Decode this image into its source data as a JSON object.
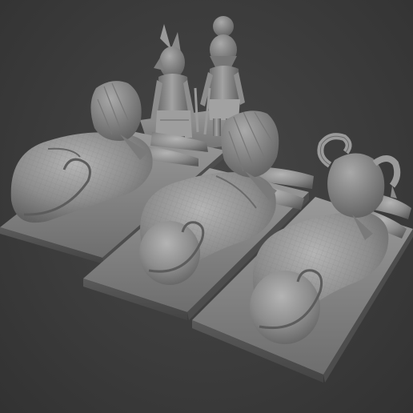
{
  "scene": {
    "background": "#3b3b3b",
    "material_color": "#8a8a8a",
    "objects": [
      {
        "name": "sphinx-left"
      },
      {
        "name": "sphinx-middle"
      },
      {
        "name": "sphinx-ram-right"
      },
      {
        "name": "figure-anubis"
      },
      {
        "name": "figure-ra"
      }
    ]
  }
}
